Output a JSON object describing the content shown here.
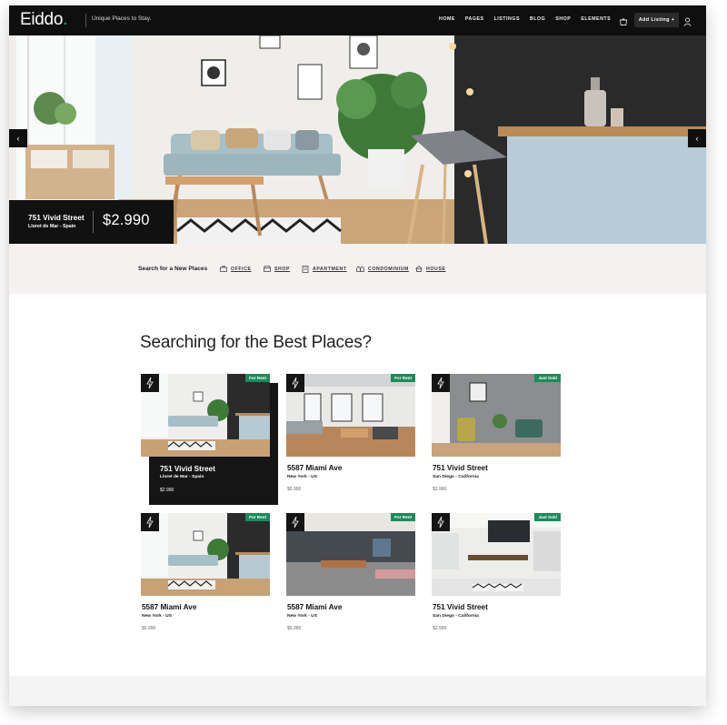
{
  "header": {
    "logo": "Eiddo",
    "logo_dot": ".",
    "tagline": "Unique Places to Stay.",
    "nav": [
      "HOME",
      "PAGES",
      "LISTINGS",
      "BLOG",
      "SHOP",
      "ELEMENTS"
    ],
    "add_listing": "Add Listing +",
    "accent": "#22b573"
  },
  "hero": {
    "title": "751 Vivid Street",
    "location": "Lloret de Mar - Spain",
    "price": "$2.990",
    "prev": "‹",
    "next": "‹"
  },
  "categories": {
    "lead": "Search for a New Places",
    "items": [
      {
        "label": "OFFICE",
        "icon": "office-icon"
      },
      {
        "label": "SHOP",
        "icon": "shop-icon"
      },
      {
        "label": "APARTMENT",
        "icon": "apartment-icon"
      },
      {
        "label": "CONDOMINIUM",
        "icon": "condominium-icon"
      },
      {
        "label": "HOUSE",
        "icon": "house-icon"
      }
    ]
  },
  "section": {
    "title": "Searching for the Best Places?"
  },
  "listings": [
    {
      "title": "751 Vivid Street",
      "location": "Lloret de Mar - Spain",
      "price": "$2.990",
      "tag": "For Rent"
    },
    {
      "title": "5587 Miami Ave",
      "location": "New York - US",
      "price": "$5.990",
      "tag": "For Rent"
    },
    {
      "title": "751 Vivid Street",
      "location": "San Diego - California",
      "price": "$2.990",
      "tag": "Just Sold"
    },
    {
      "title": "5587 Miami Ave",
      "location": "New York - US",
      "price": "$5.990",
      "tag": "For Rent"
    },
    {
      "title": "5587 Miami Ave",
      "location": "New York - US",
      "price": "$5.990",
      "tag": "For Rent"
    },
    {
      "title": "751 Vivid Street",
      "location": "San Diego - California",
      "price": "$2.990",
      "tag": "Just Sold"
    }
  ]
}
